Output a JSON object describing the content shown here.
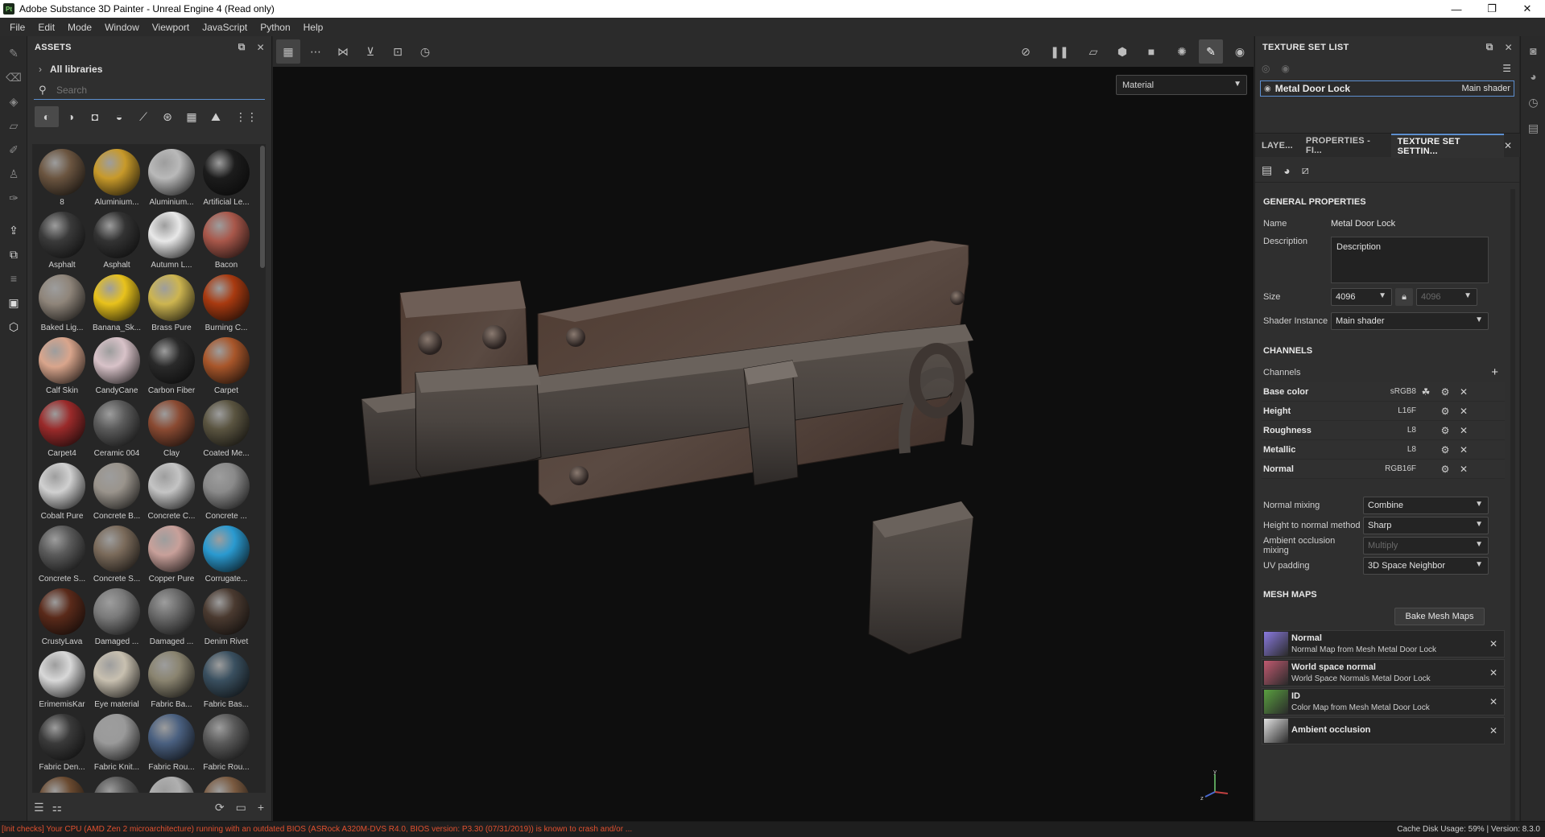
{
  "window": {
    "icon_text": "Pt",
    "title": "Adobe Substance 3D Painter - Unreal Engine 4 (Read only)",
    "controls": [
      "—",
      "❐",
      "✕"
    ]
  },
  "menu": [
    "File",
    "Edit",
    "Mode",
    "Window",
    "Viewport",
    "JavaScript",
    "Python",
    "Help"
  ],
  "assets": {
    "header": "ASSETS",
    "libraries": "All libraries",
    "search_placeholder": "Search",
    "items": [
      {
        "label": "8",
        "color": "#6b5540"
      },
      {
        "label": "Aluminium...",
        "color": "#c89a2a"
      },
      {
        "label": "Aluminium...",
        "color": "#b9b9b9"
      },
      {
        "label": "Artificial Le...",
        "color": "#1c1c1c"
      },
      {
        "label": "Asphalt",
        "color": "#3a3a3a"
      },
      {
        "label": "Asphalt",
        "color": "#333333"
      },
      {
        "label": "Autumn L...",
        "color": "#e8e8e8"
      },
      {
        "label": "Bacon",
        "color": "#a8574a"
      },
      {
        "label": "Baked Lig...",
        "color": "#8f857a"
      },
      {
        "label": "Banana_Sk...",
        "color": "#e8c21c"
      },
      {
        "label": "Brass Pure",
        "color": "#cdb550"
      },
      {
        "label": "Burning C...",
        "color": "#a83a10"
      },
      {
        "label": "Calf Skin",
        "color": "#d9a58c"
      },
      {
        "label": "CandyCane",
        "color": "#d8c2c8"
      },
      {
        "label": "Carbon Fiber",
        "color": "#2a2a2a"
      },
      {
        "label": "Carpet",
        "color": "#a8562a"
      },
      {
        "label": "Carpet4",
        "color": "#9a2a2a"
      },
      {
        "label": "Ceramic 004",
        "color": "#5a5a5a"
      },
      {
        "label": "Clay",
        "color": "#8a4a32"
      },
      {
        "label": "Coated Me...",
        "color": "#5a5440"
      },
      {
        "label": "Cobalt Pure",
        "color": "#d0d0d0"
      },
      {
        "label": "Concrete B...",
        "color": "#9a948c"
      },
      {
        "label": "Concrete C...",
        "color": "#c4c4c4"
      },
      {
        "label": "Concrete ...",
        "color": "#8a8a8a"
      },
      {
        "label": "Concrete S...",
        "color": "#5a5a5a"
      },
      {
        "label": "Concrete S...",
        "color": "#7a6a5a"
      },
      {
        "label": "Copper Pure",
        "color": "#c8a09a"
      },
      {
        "label": "Corrugate...",
        "color": "#2a9ad0"
      },
      {
        "label": "CrustyLava",
        "color": "#5a2a1a"
      },
      {
        "label": "Damaged ...",
        "color": "#7a7a7a"
      },
      {
        "label": "Damaged ...",
        "color": "#6a6a6a"
      },
      {
        "label": "Denim Rivet",
        "color": "#4a3a30"
      },
      {
        "label": "ErimemisKar",
        "color": "#d8d8d8"
      },
      {
        "label": "Eye material",
        "color": "#c8c0b0"
      },
      {
        "label": "Fabric Ba...",
        "color": "#8a8470"
      },
      {
        "label": "Fabric Bas...",
        "color": "#3a5060"
      },
      {
        "label": "Fabric Den...",
        "color": "#3a3a3a"
      },
      {
        "label": "Fabric Knit...",
        "color": "#9a9a9a"
      },
      {
        "label": "Fabric Rou...",
        "color": "#4a6080"
      },
      {
        "label": "Fabric Rou...",
        "color": "#5a5a5a"
      },
      {
        "label": "",
        "color": "#6a4a30"
      },
      {
        "label": "",
        "color": "#5a5a5a"
      },
      {
        "label": "",
        "color": "#b0b0b0"
      },
      {
        "label": "",
        "color": "#7a5a40"
      }
    ]
  },
  "viewport": {
    "material_mode": "Material"
  },
  "texture_set_list": {
    "header": "TEXTURE SET LIST",
    "set_name": "Metal Door Lock",
    "shader": "Main shader"
  },
  "tabs": [
    "LAYE...",
    "PROPERTIES - FI...",
    "TEXTURE SET SETTIN..."
  ],
  "texture_set_settings": {
    "general_title": "GENERAL PROPERTIES",
    "name_label": "Name",
    "name_value": "Metal Door Lock",
    "description_label": "Description",
    "description_value": "Description",
    "size_label": "Size",
    "size_value": "4096",
    "size_linked_value": "4096",
    "shader_label": "Shader Instance",
    "shader_value": "Main shader",
    "channels_title": "CHANNELS",
    "channels_label": "Channels",
    "channels": [
      {
        "name": "Base color",
        "format": "sRGB8"
      },
      {
        "name": "Height",
        "format": "L16F"
      },
      {
        "name": "Roughness",
        "format": "L8"
      },
      {
        "name": "Metallic",
        "format": "L8"
      },
      {
        "name": "Normal",
        "format": "RGB16F"
      }
    ],
    "normal_mixing_label": "Normal mixing",
    "normal_mixing_value": "Combine",
    "height_to_normal_label": "Height to normal method",
    "height_to_normal_value": "Sharp",
    "ao_mixing_label": "Ambient occlusion mixing",
    "ao_mixing_value": "Multiply",
    "uv_padding_label": "UV padding",
    "uv_padding_value": "3D Space Neighbor",
    "mesh_maps_title": "MESH MAPS",
    "bake_button": "Bake Mesh Maps",
    "mesh_maps": [
      {
        "title": "Normal",
        "subtitle": "Normal Map from Mesh Metal Door Lock",
        "color": "#8a7ae0"
      },
      {
        "title": "World space normal",
        "subtitle": "World Space Normals Metal Door Lock",
        "color": "#c05a70"
      },
      {
        "title": "ID",
        "subtitle": "Color Map from Mesh Metal Door Lock",
        "color": "#5aa040"
      },
      {
        "title": "Ambient occlusion",
        "subtitle": "",
        "color": "#e0e0e0"
      }
    ]
  },
  "status": {
    "warning": "[Init checks] Your CPU (AMD Zen 2 microarchitecture) running with an outdated BIOS (ASRock A320M-DVS R4.0, BIOS version: P3.30 (07/31/2019)) is known to crash and/or ...",
    "right": "Cache Disk Usage:   59% | Version: 8.3.0"
  }
}
